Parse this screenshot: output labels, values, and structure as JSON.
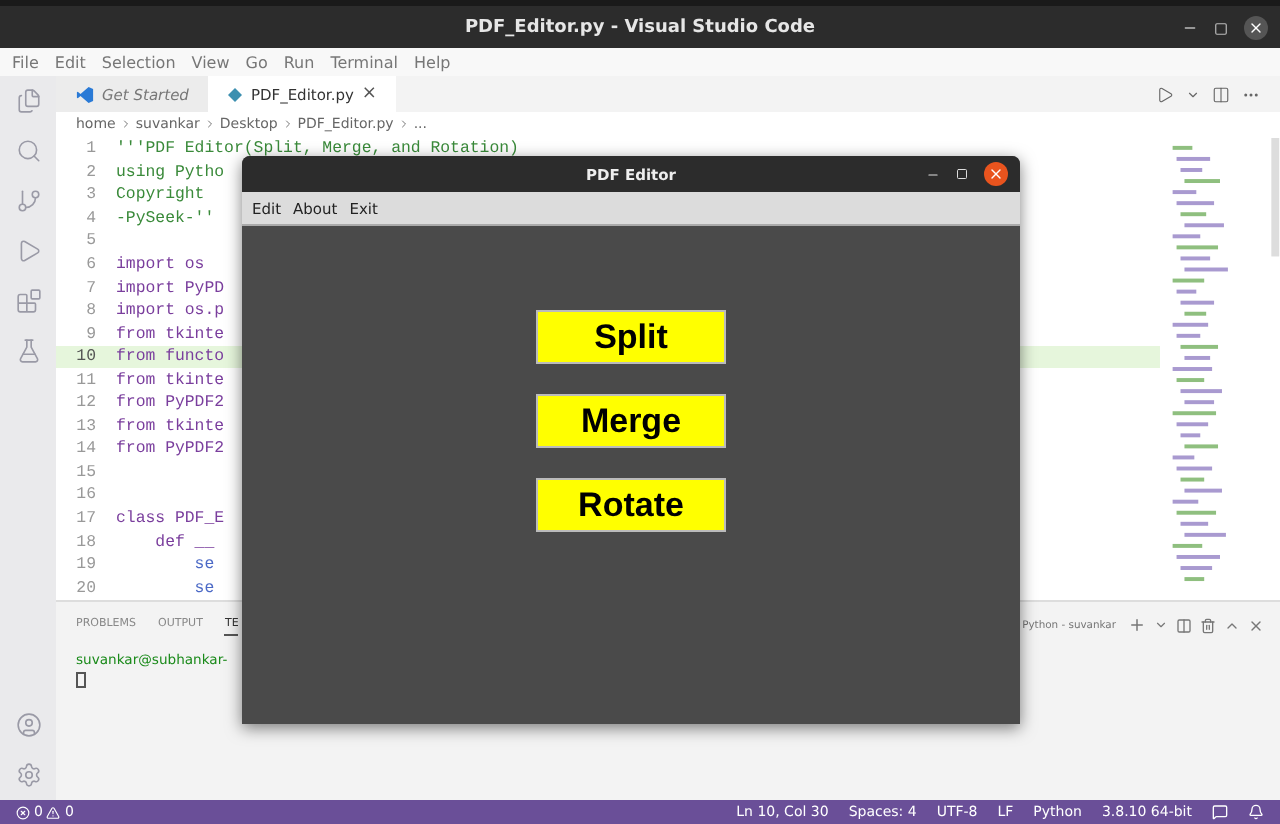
{
  "window": {
    "title": "PDF_Editor.py - Visual Studio Code"
  },
  "menu": [
    "File",
    "Edit",
    "Selection",
    "View",
    "Go",
    "Run",
    "Terminal",
    "Help"
  ],
  "tabs": [
    {
      "label": "Get Started",
      "kind": "welcome",
      "selected": false
    },
    {
      "label": "PDF_Editor.py",
      "kind": "python",
      "selected": true,
      "close": "×"
    }
  ],
  "breadcrumb": [
    "home",
    "suvankar",
    "Desktop",
    "PDF_Editor.py",
    "..."
  ],
  "code_lines": [
    {
      "number": "1",
      "text": "'''PDF Editor(Split, Merge, and Rotation)",
      "kind": "string",
      "current": false
    },
    {
      "number": "2",
      "text": "using Pytho",
      "kind": "string",
      "current": false
    },
    {
      "number": "3",
      "text": "Copyright",
      "kind": "string",
      "current": false
    },
    {
      "number": "4",
      "text": "-PySeek-''",
      "kind": "string",
      "current": false
    },
    {
      "number": "5",
      "current": false
    },
    {
      "number": "6",
      "text": "import os",
      "kind": "keyword",
      "current": false
    },
    {
      "number": "7",
      "text": "import PyPD",
      "kind": "keyword",
      "current": false
    },
    {
      "number": "8",
      "text": "import os.p",
      "kind": "keyword",
      "current": false
    },
    {
      "number": "9",
      "text": "from tkinte",
      "kind": "keyword",
      "current": false
    },
    {
      "number": "10",
      "text": "from functo",
      "kind": "keyword",
      "current": true
    },
    {
      "number": "11",
      "text": "from tkinte",
      "kind": "keyword",
      "current": false
    },
    {
      "number": "12",
      "text": "from PyPDF2",
      "kind": "keyword",
      "current": false
    },
    {
      "number": "13",
      "text": "from tkinte",
      "kind": "keyword",
      "current": false
    },
    {
      "number": "14",
      "text": "from PyPDF2",
      "kind": "keyword",
      "current": false
    },
    {
      "number": "15",
      "current": false
    },
    {
      "number": "16",
      "current": false
    },
    {
      "number": "17",
      "text": "class PDF_E",
      "kind": "keyword",
      "current": false
    },
    {
      "number": "18",
      "text": "    def __",
      "kind": "keyword",
      "current": false
    },
    {
      "number": "19",
      "text": "        se",
      "kind": "plain",
      "current": false
    },
    {
      "number": "20",
      "text": "        se",
      "kind": "plain",
      "current": false
    }
  ],
  "panel": {
    "tabs": [
      {
        "label": "PROBLEMS",
        "selected": false
      },
      {
        "label": "OUTPUT",
        "selected": false
      },
      {
        "label": "TE",
        "selected": true
      }
    ],
    "terminal_name": "Python - suvankar",
    "prompt": "suvankar@subhankar-"
  },
  "status_bar": {
    "errors": "0",
    "warnings": "0",
    "items": [
      "Ln 10, Col 30",
      "Spaces: 4",
      "UTF-8",
      "LF",
      "Python",
      "3.8.10 64-bit"
    ]
  },
  "dialog": {
    "title": "PDF Editor",
    "menu": [
      "Edit",
      "About",
      "Exit"
    ],
    "buttons": [
      "Split",
      "Merge",
      "Rotate"
    ]
  }
}
